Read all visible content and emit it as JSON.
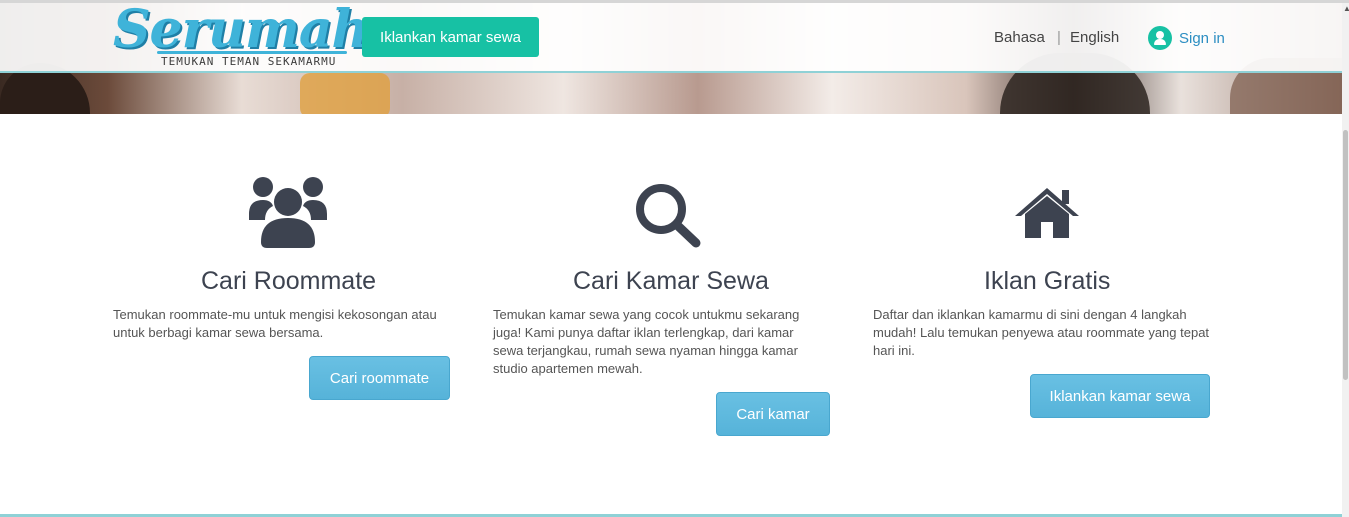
{
  "header": {
    "logo_text": "Serumah",
    "logo_tagline": "TEMUKAN TEMAN SEKAMARMU",
    "advertise_button": "Iklankan kamar sewa",
    "lang_bahasa": "Bahasa",
    "lang_separator": "|",
    "lang_english": "English",
    "signin_label": "Sign in"
  },
  "features": [
    {
      "icon": "users-group-icon",
      "title": "Cari Roommate",
      "description": "Temukan roommate-mu untuk mengisi kekosongan atau untuk berbagi kamar sewa bersama.",
      "button": "Cari roommate"
    },
    {
      "icon": "search-icon",
      "title": "Cari Kamar Sewa",
      "description": "Temukan kamar sewa yang cocok untukmu sekarang juga! Kami punya daftar iklan terlengkap, dari kamar sewa terjangkau, rumah sewa nyaman hingga kamar studio apartemen mewah.",
      "button": "Cari kamar"
    },
    {
      "icon": "house-icon",
      "title": "Iklan Gratis",
      "description": "Daftar dan iklankan kamarmu di sini dengan 4 langkah mudah! Lalu temukan penyewa atau roommate yang tepat hari ini.",
      "button": "Iklankan kamar sewa"
    }
  ],
  "colors": {
    "accent_teal": "#17c1a4",
    "button_blue": "#5ab6dc",
    "logo_blue": "#3fb3d9",
    "icon_dark": "#3d4350"
  }
}
